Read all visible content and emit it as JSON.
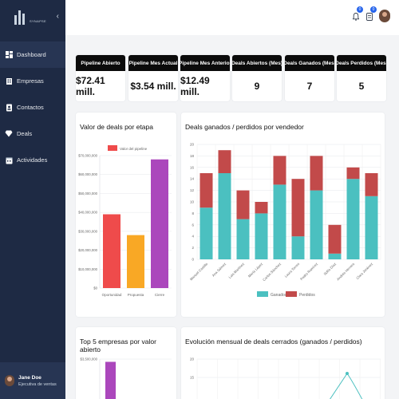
{
  "app": {
    "brand": "SYNAPSE"
  },
  "sidebar": {
    "items": [
      {
        "label": "Dashboard",
        "icon": "dashboard-icon"
      },
      {
        "label": "Empresas",
        "icon": "building-icon"
      },
      {
        "label": "Contactos",
        "icon": "contact-card-icon"
      },
      {
        "label": "Deals",
        "icon": "diamond-icon"
      },
      {
        "label": "Actividades",
        "icon": "calendar-icon"
      }
    ],
    "user": {
      "name": "Jane Doe",
      "role": "Ejecutiva de ventas"
    }
  },
  "topbar": {
    "notifications_count": "0",
    "alerts_count": "0"
  },
  "kpis": [
    {
      "label": "Pipeline Abierto",
      "value": "$72.41 mill."
    },
    {
      "label": "Pipeline Mes Actual",
      "value": "$3.54 mill."
    },
    {
      "label": "Pipeline Mes Anterior",
      "value": "$12.49 mill."
    },
    {
      "label": "Deals Abiertos (Mes)",
      "value": "9"
    },
    {
      "label": "Deals Ganados (Mes)",
      "value": "7"
    },
    {
      "label": "Deals Perdidos (Mes)",
      "value": "5"
    }
  ],
  "colors": {
    "sidebar": "#1e2a44",
    "ganados": "#4bc0c0",
    "perdidos": "#c24a4a",
    "oportunidad": "#ef4b4b",
    "propuesta": "#f9a825",
    "cierre": "#ab47bc"
  },
  "charts": {
    "stage": {
      "title": "Valor de deals por etapa",
      "legend": "Valor del pipeline",
      "ticks": [
        "$0",
        "$10,000,000",
        "$20,000,000",
        "$30,000,000",
        "$40,000,000",
        "$50,000,000",
        "$60,000,000",
        "$70,000,000"
      ]
    },
    "seller": {
      "title": "Deals ganados / perdidos por vendedor",
      "ticks": [
        "0",
        "2",
        "4",
        "6",
        "8",
        "10",
        "12",
        "14",
        "16",
        "18",
        "20"
      ]
    },
    "top5": {
      "title": "Top 5 empresas por valor abierto",
      "ticks": [
        "$3,500,000"
      ]
    },
    "monthly": {
      "title": "Evolución mensual de deals cerrados (ganados / perdidos)",
      "ticks": [
        "20",
        "15"
      ]
    }
  },
  "chart_data": [
    {
      "type": "bar",
      "title": "Valor de deals por etapa",
      "categories": [
        "Oportunidad",
        "Propuesta",
        "Cierre"
      ],
      "series": [
        {
          "name": "Valor del pipeline",
          "values": [
            39000000,
            28000000,
            68000000
          ]
        }
      ],
      "ylim": [
        0,
        70000000
      ],
      "legend": "top"
    },
    {
      "type": "bar",
      "stacked": true,
      "title": "Deals ganados / perdidos por vendedor",
      "categories": [
        "Manuel Castillo",
        "Ana Gómez",
        "Luis Martínez",
        "María López",
        "Carlos Sánchez",
        "Laura Torres",
        "Pedro Ramírez",
        "Sofía Díaz",
        "Andrés Herrera",
        "Clara Jiménez"
      ],
      "series": [
        {
          "name": "Ganados",
          "values": [
            9,
            15,
            7,
            8,
            13,
            4,
            12,
            1,
            14,
            11
          ]
        },
        {
          "name": "Perdidos",
          "values": [
            6,
            4,
            5,
            2,
            5,
            10,
            6,
            5,
            2,
            4
          ]
        }
      ],
      "ylim": [
        0,
        20
      ],
      "legend": "bottom"
    },
    {
      "type": "bar",
      "title": "Top 5 empresas por valor abierto",
      "values": [
        3300000
      ]
    },
    {
      "type": "line",
      "title": "Evolución mensual de deals cerrados (ganados / perdidos)",
      "ylim": [
        15,
        20
      ]
    }
  ]
}
